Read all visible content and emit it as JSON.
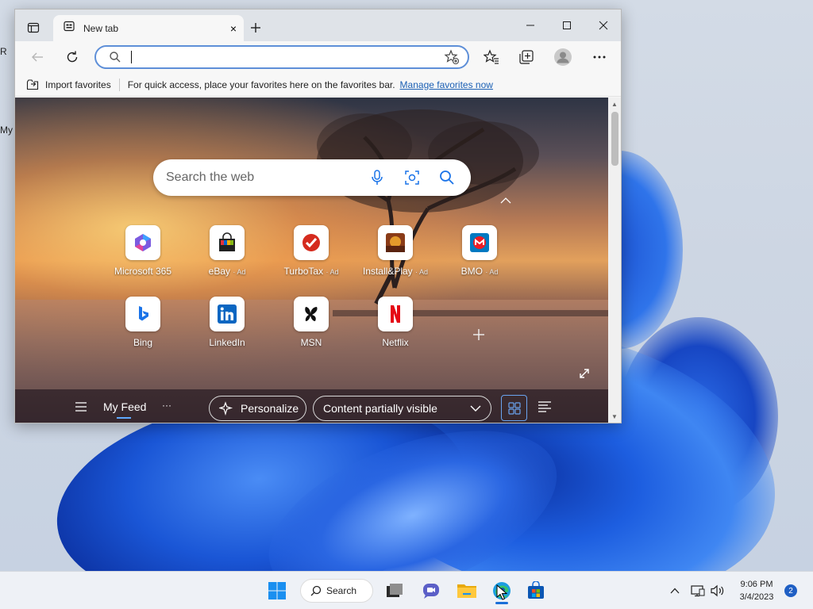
{
  "desktop": {
    "label_r": "R",
    "label_my": "My"
  },
  "browser": {
    "tab_title": "New tab",
    "tab_close": "×",
    "address_value": "",
    "favorites_bar": {
      "import_label": "Import favorites",
      "message": "For quick access, place your favorites here on the favorites bar.",
      "manage_link": "Manage favorites now"
    }
  },
  "newtab": {
    "search_placeholder": "Search the web",
    "tiles": [
      {
        "name": "Microsoft 365",
        "ad": "",
        "icon": "microsoft-365-icon",
        "color": "#7b5be0"
      },
      {
        "name": "eBay",
        "ad": "· Ad",
        "icon": "ebay-icon",
        "color": "#e53238"
      },
      {
        "name": "TurboTax",
        "ad": "· Ad",
        "icon": "turbotax-icon",
        "color": "#d52b1e"
      },
      {
        "name": "Install&Play",
        "ad": "· Ad",
        "icon": "install-play-icon",
        "color": "#c0742a"
      },
      {
        "name": "BMO",
        "ad": "· Ad",
        "icon": "bmo-icon",
        "color": "#0079c1"
      },
      {
        "name": "Bing",
        "ad": "",
        "icon": "bing-icon",
        "color": "#1a73e8"
      },
      {
        "name": "LinkedIn",
        "ad": "",
        "icon": "linkedin-icon",
        "color": "#0a66c2"
      },
      {
        "name": "MSN",
        "ad": "",
        "icon": "msn-icon",
        "color": "#111111"
      },
      {
        "name": "Netflix",
        "ad": "",
        "icon": "netflix-icon",
        "color": "#e50914"
      }
    ],
    "feed": {
      "my_feed": "My Feed",
      "more": "···",
      "personalize": "Personalize",
      "content_select": "Content partially visible"
    }
  },
  "taskbar": {
    "search_label": "Search",
    "time": "9:06 PM",
    "date": "3/4/2023",
    "notification_count": "2"
  }
}
